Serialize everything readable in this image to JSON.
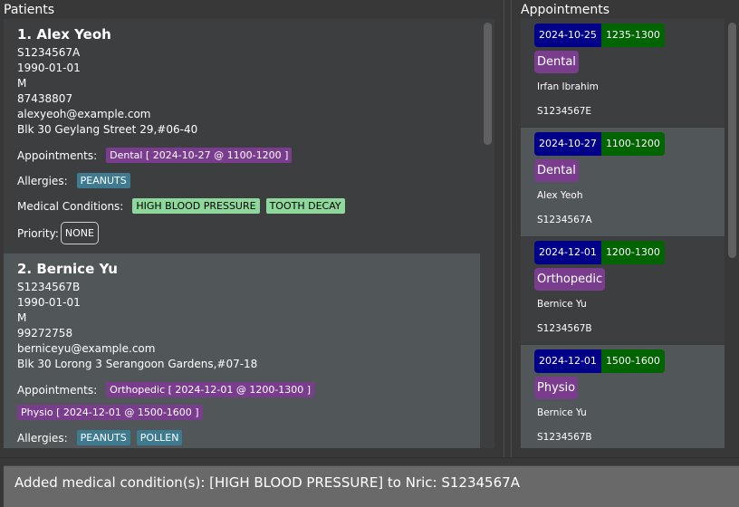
{
  "patients_panel": {
    "title": "Patients",
    "labels": {
      "appointments": "Appointments:",
      "allergies": "Allergies:",
      "medical_conditions": "Medical Conditions:",
      "priority": "Priority:"
    },
    "patients": [
      {
        "index_name": "1.  Alex Yeoh",
        "nric": "S1234567A",
        "dob": "1990-01-01",
        "sex": "M",
        "phone": "87438807",
        "email": "alexyeoh@example.com",
        "address": "Blk 30 Geylang Street 29,#06-40",
        "appointments": [
          "Dental [ 2024-10-27 @ 1100-1200 ]"
        ],
        "allergies": [
          "PEANUTS"
        ],
        "medical_conditions": [
          "HIGH BLOOD PRESSURE",
          "TOOTH DECAY"
        ],
        "priority": "NONE"
      },
      {
        "index_name": "2.  Bernice Yu",
        "nric": "S1234567B",
        "dob": "1990-01-01",
        "sex": "M",
        "phone": "99272758",
        "email": "berniceyu@example.com",
        "address": "Blk 30 Lorong 3 Serangoon Gardens,#07-18",
        "appointments": [
          "Orthopedic [ 2024-12-01 @ 1200-1300 ]",
          "Physio [ 2024-12-01 @ 1500-1600 ]"
        ],
        "allergies": [
          "PEANUTS",
          "POLLEN"
        ]
      }
    ]
  },
  "appointments_panel": {
    "title": "Appointments",
    "appointments": [
      {
        "date": "2024-10-25",
        "time": "1235-1300",
        "type": "Dental",
        "name": "Irfan Ibrahim",
        "nric": "S1234567E"
      },
      {
        "date": "2024-10-27",
        "time": "1100-1200",
        "type": "Dental",
        "name": "Alex Yeoh",
        "nric": "S1234567A"
      },
      {
        "date": "2024-12-01",
        "time": "1200-1300",
        "type": "Orthopedic",
        "name": "Bernice Yu",
        "nric": "S1234567B"
      },
      {
        "date": "2024-12-01",
        "time": "1500-1600",
        "type": "Physio",
        "name": "Bernice Yu",
        "nric": "S1234567B"
      }
    ]
  },
  "result_display": {
    "message": "Added medical condition(s): [HIGH BLOOD PRESSURE] to Nric: S1234567A"
  },
  "colors": {
    "appointment_tag": "#7a3d8e",
    "allergy_tag": "#3e7b91",
    "condition_tag": "#8fd89b",
    "date_badge": "#000088",
    "time_badge": "#006400"
  }
}
